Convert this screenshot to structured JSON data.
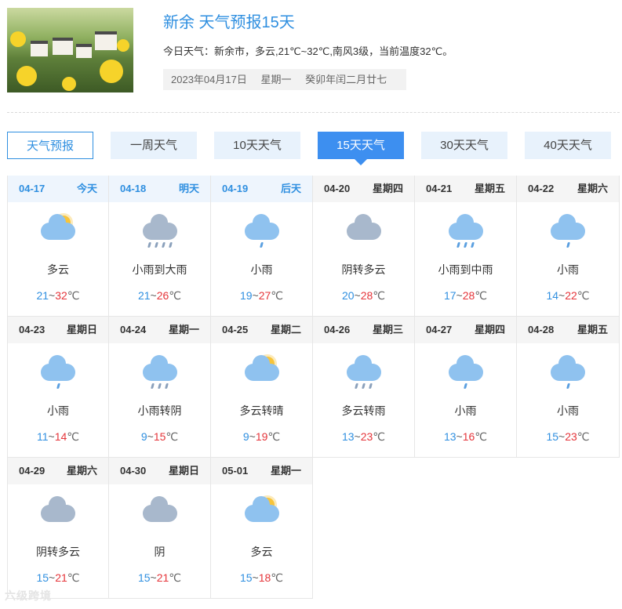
{
  "header": {
    "title": "新余 天气预报15天",
    "today_summary": "今日天气：新余市，多云,21℃~32℃,南风3级，当前温度32℃。",
    "date": "2023年04月17日",
    "weekday": "星期一",
    "lunar": "癸卯年闰二月廿七"
  },
  "tabs": [
    {
      "label": "天气预报"
    },
    {
      "label": "一周天气"
    },
    {
      "label": "10天天气"
    },
    {
      "label": "15天天气"
    },
    {
      "label": "30天天气"
    },
    {
      "label": "40天天气"
    }
  ],
  "active_tab": "15天天气",
  "forecast": [
    {
      "date": "04-17",
      "day": "今天",
      "cond": "多云",
      "low": "21",
      "high": "32",
      "icon": "partly-cloudy-icon"
    },
    {
      "date": "04-18",
      "day": "明天",
      "cond": "小雨到大雨",
      "low": "21",
      "high": "26",
      "icon": "heavy-rain-icon"
    },
    {
      "date": "04-19",
      "day": "后天",
      "cond": "小雨",
      "low": "19",
      "high": "27",
      "icon": "light-rain-icon"
    },
    {
      "date": "04-20",
      "day": "星期四",
      "cond": "阴转多云",
      "low": "20",
      "high": "28",
      "icon": "overcast-icon"
    },
    {
      "date": "04-21",
      "day": "星期五",
      "cond": "小雨到中雨",
      "low": "17",
      "high": "28",
      "icon": "moderate-rain-icon"
    },
    {
      "date": "04-22",
      "day": "星期六",
      "cond": "小雨",
      "low": "14",
      "high": "22",
      "icon": "light-rain-icon"
    },
    {
      "date": "04-23",
      "day": "星期日",
      "cond": "小雨",
      "low": "11",
      "high": "14",
      "icon": "light-rain-icon"
    },
    {
      "date": "04-24",
      "day": "星期一",
      "cond": "小雨转阴",
      "low": "9",
      "high": "15",
      "icon": "rain-to-overcast-icon"
    },
    {
      "date": "04-25",
      "day": "星期二",
      "cond": "多云转晴",
      "low": "9",
      "high": "19",
      "icon": "partly-cloudy-icon"
    },
    {
      "date": "04-26",
      "day": "星期三",
      "cond": "多云转雨",
      "low": "13",
      "high": "23",
      "icon": "cloudy-to-rain-icon"
    },
    {
      "date": "04-27",
      "day": "星期四",
      "cond": "小雨",
      "low": "13",
      "high": "16",
      "icon": "light-rain-icon"
    },
    {
      "date": "04-28",
      "day": "星期五",
      "cond": "小雨",
      "low": "15",
      "high": "23",
      "icon": "light-rain-icon"
    },
    {
      "date": "04-29",
      "day": "星期六",
      "cond": "阴转多云",
      "low": "15",
      "high": "21",
      "icon": "overcast-icon"
    },
    {
      "date": "04-30",
      "day": "星期日",
      "cond": "阴",
      "low": "15",
      "high": "21",
      "icon": "overcast-icon"
    },
    {
      "date": "05-01",
      "day": "星期一",
      "cond": "多云",
      "low": "15",
      "high": "18",
      "icon": "partly-cloudy-icon"
    }
  ],
  "temp_separator": "~",
  "temp_unit": "℃",
  "watermark": "六级跨境",
  "colors": {
    "accent": "#2f8fe0",
    "active_tab": "#3d8ff0",
    "tab_bg": "#e8f2fc",
    "low_temp": "#2f8fe0",
    "high_temp": "#e5353a"
  }
}
